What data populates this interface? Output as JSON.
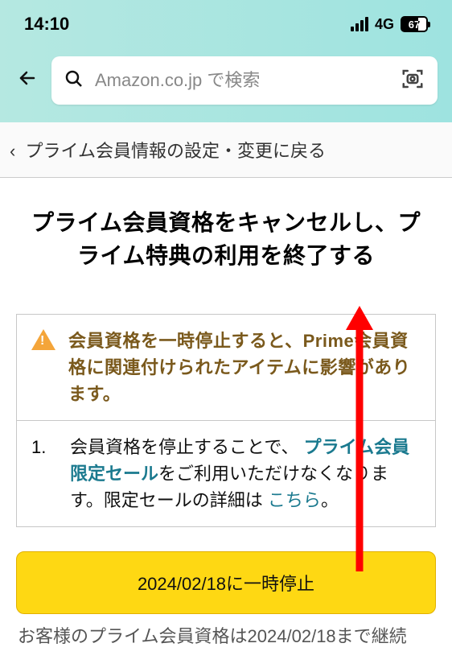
{
  "status": {
    "time": "14:10",
    "network": "4G",
    "battery": "67"
  },
  "search": {
    "placeholder": "Amazon.co.jp で検索"
  },
  "breadcrumb": {
    "caret": "‹",
    "text": "プライム会員情報の設定・変更に戻る"
  },
  "title": "プライム会員資格をキャンセルし、プライム特典の利用を終了する",
  "alert": {
    "warning": "会員資格を一時停止すると、Prime会員資格に関連付けられたアイテムに影響があります。",
    "items": [
      {
        "number": "1.",
        "prefix": "会員資格を停止することで、",
        "link_bold": "プライム会員限定セール",
        "middle": "をご利用いただけなくなります。限定セールの詳細は ",
        "link_plain": "こちら",
        "suffix": "。"
      }
    ]
  },
  "button": {
    "pause": "2024/02/18に一時停止"
  },
  "footer": "お客様のプライム会員資格は2024/02/18まで継続"
}
